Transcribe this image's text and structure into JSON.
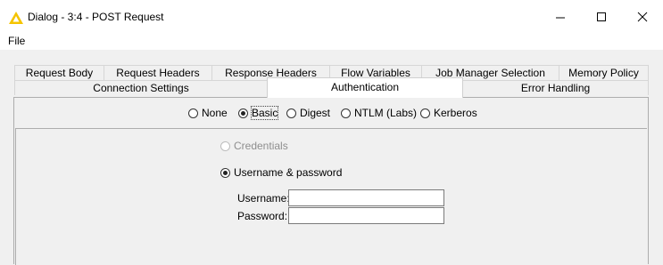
{
  "window": {
    "title": "Dialog - 3:4 - POST Request",
    "icon": "knime-warning-triangle-icon",
    "controls": [
      "minimize-icon",
      "maximize-icon",
      "close-icon"
    ]
  },
  "menu": {
    "file": "File"
  },
  "tabs": {
    "row_top": [
      "Request Body",
      "Request Headers",
      "Response Headers",
      "Flow Variables",
      "Job Manager Selection",
      "Memory Policy"
    ],
    "row_bottom": [
      "Connection Settings",
      "Authentication",
      "Error Handling"
    ],
    "active": "Authentication"
  },
  "auth": {
    "options": [
      "None",
      "Basic",
      "Digest",
      "NTLM (Labs)",
      "Kerberos"
    ],
    "selected": "Basic",
    "credentials_label": "Credentials",
    "userpass_label": "Username & password",
    "username_label": "Username:",
    "password_label": "Password:",
    "username_value": "",
    "password_value": ""
  },
  "colors": {
    "accent_icon": "#f5c400",
    "panel_bg": "#f0f0f0",
    "border": "#adadad"
  }
}
